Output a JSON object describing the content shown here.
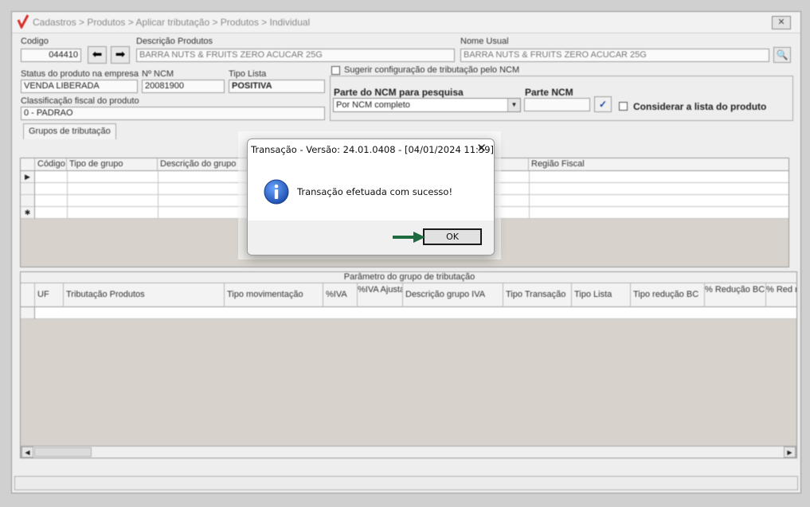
{
  "window": {
    "title": "Cadastros > Produtos > Aplicar tributação > Produtos > Individual",
    "close_label": "✕"
  },
  "product": {
    "codigo_label": "Codigo",
    "codigo_value": "044410",
    "descricao_label": "Descrição Produtos",
    "descricao_value": "BARRA NUTS & FRUITS ZERO ACUCAR 25G",
    "nome_usual_label": "Nome Usual",
    "nome_usual_value": "BARRA NUTS & FRUITS ZERO ACUCAR 25G",
    "status_label": "Status do produto na empresa",
    "status_value": "VENDA LIBERADA",
    "ncm_label": "Nº NCM",
    "ncm_value": "20081900",
    "tipo_lista_label": "Tipo Lista",
    "tipo_lista_value": "POSITIVA",
    "classificacao_label": "Classificação fiscal do produto",
    "classificacao_value": "0 - PADRAO"
  },
  "ncm_group": {
    "sugerir_label": "Sugerir configuração de tributação pelo NCM",
    "parte_pesquisa_label": "Parte do NCM para pesquisa",
    "parte_pesquisa_value": "Por NCM completo",
    "parte_ncm_label": "Parte NCM",
    "parte_ncm_value": "",
    "considerar_label": "Considerar a lista do produto"
  },
  "tabs": {
    "grupos": "Grupos de tributação"
  },
  "grid1": {
    "columns": [
      "Código",
      "Tipo de grupo",
      "Descrição do grupo",
      "Região Fiscal"
    ]
  },
  "grid2": {
    "caption": "Parâmetro do grupo de tributação",
    "columns": [
      "UF",
      "Tributação Produtos",
      "Tipo movimentação",
      "%IVA",
      "%IVA Ajustado",
      "Descrição grupo IVA",
      "Tipo Transação",
      "Tipo Lista",
      "Tipo redução BC",
      "% Redução BC nacional",
      "% Red nac"
    ]
  },
  "dialog": {
    "title": "Transação - Versão: 24.01.0408 - [04/01/2024 11:59]",
    "close": "✕",
    "message": "Transação efetuada com sucesso!",
    "ok_label": "OK"
  },
  "colors": {
    "arrow": "#1e6b3f",
    "info_icon": "#1f5fbf",
    "logo": "#d6302a"
  }
}
